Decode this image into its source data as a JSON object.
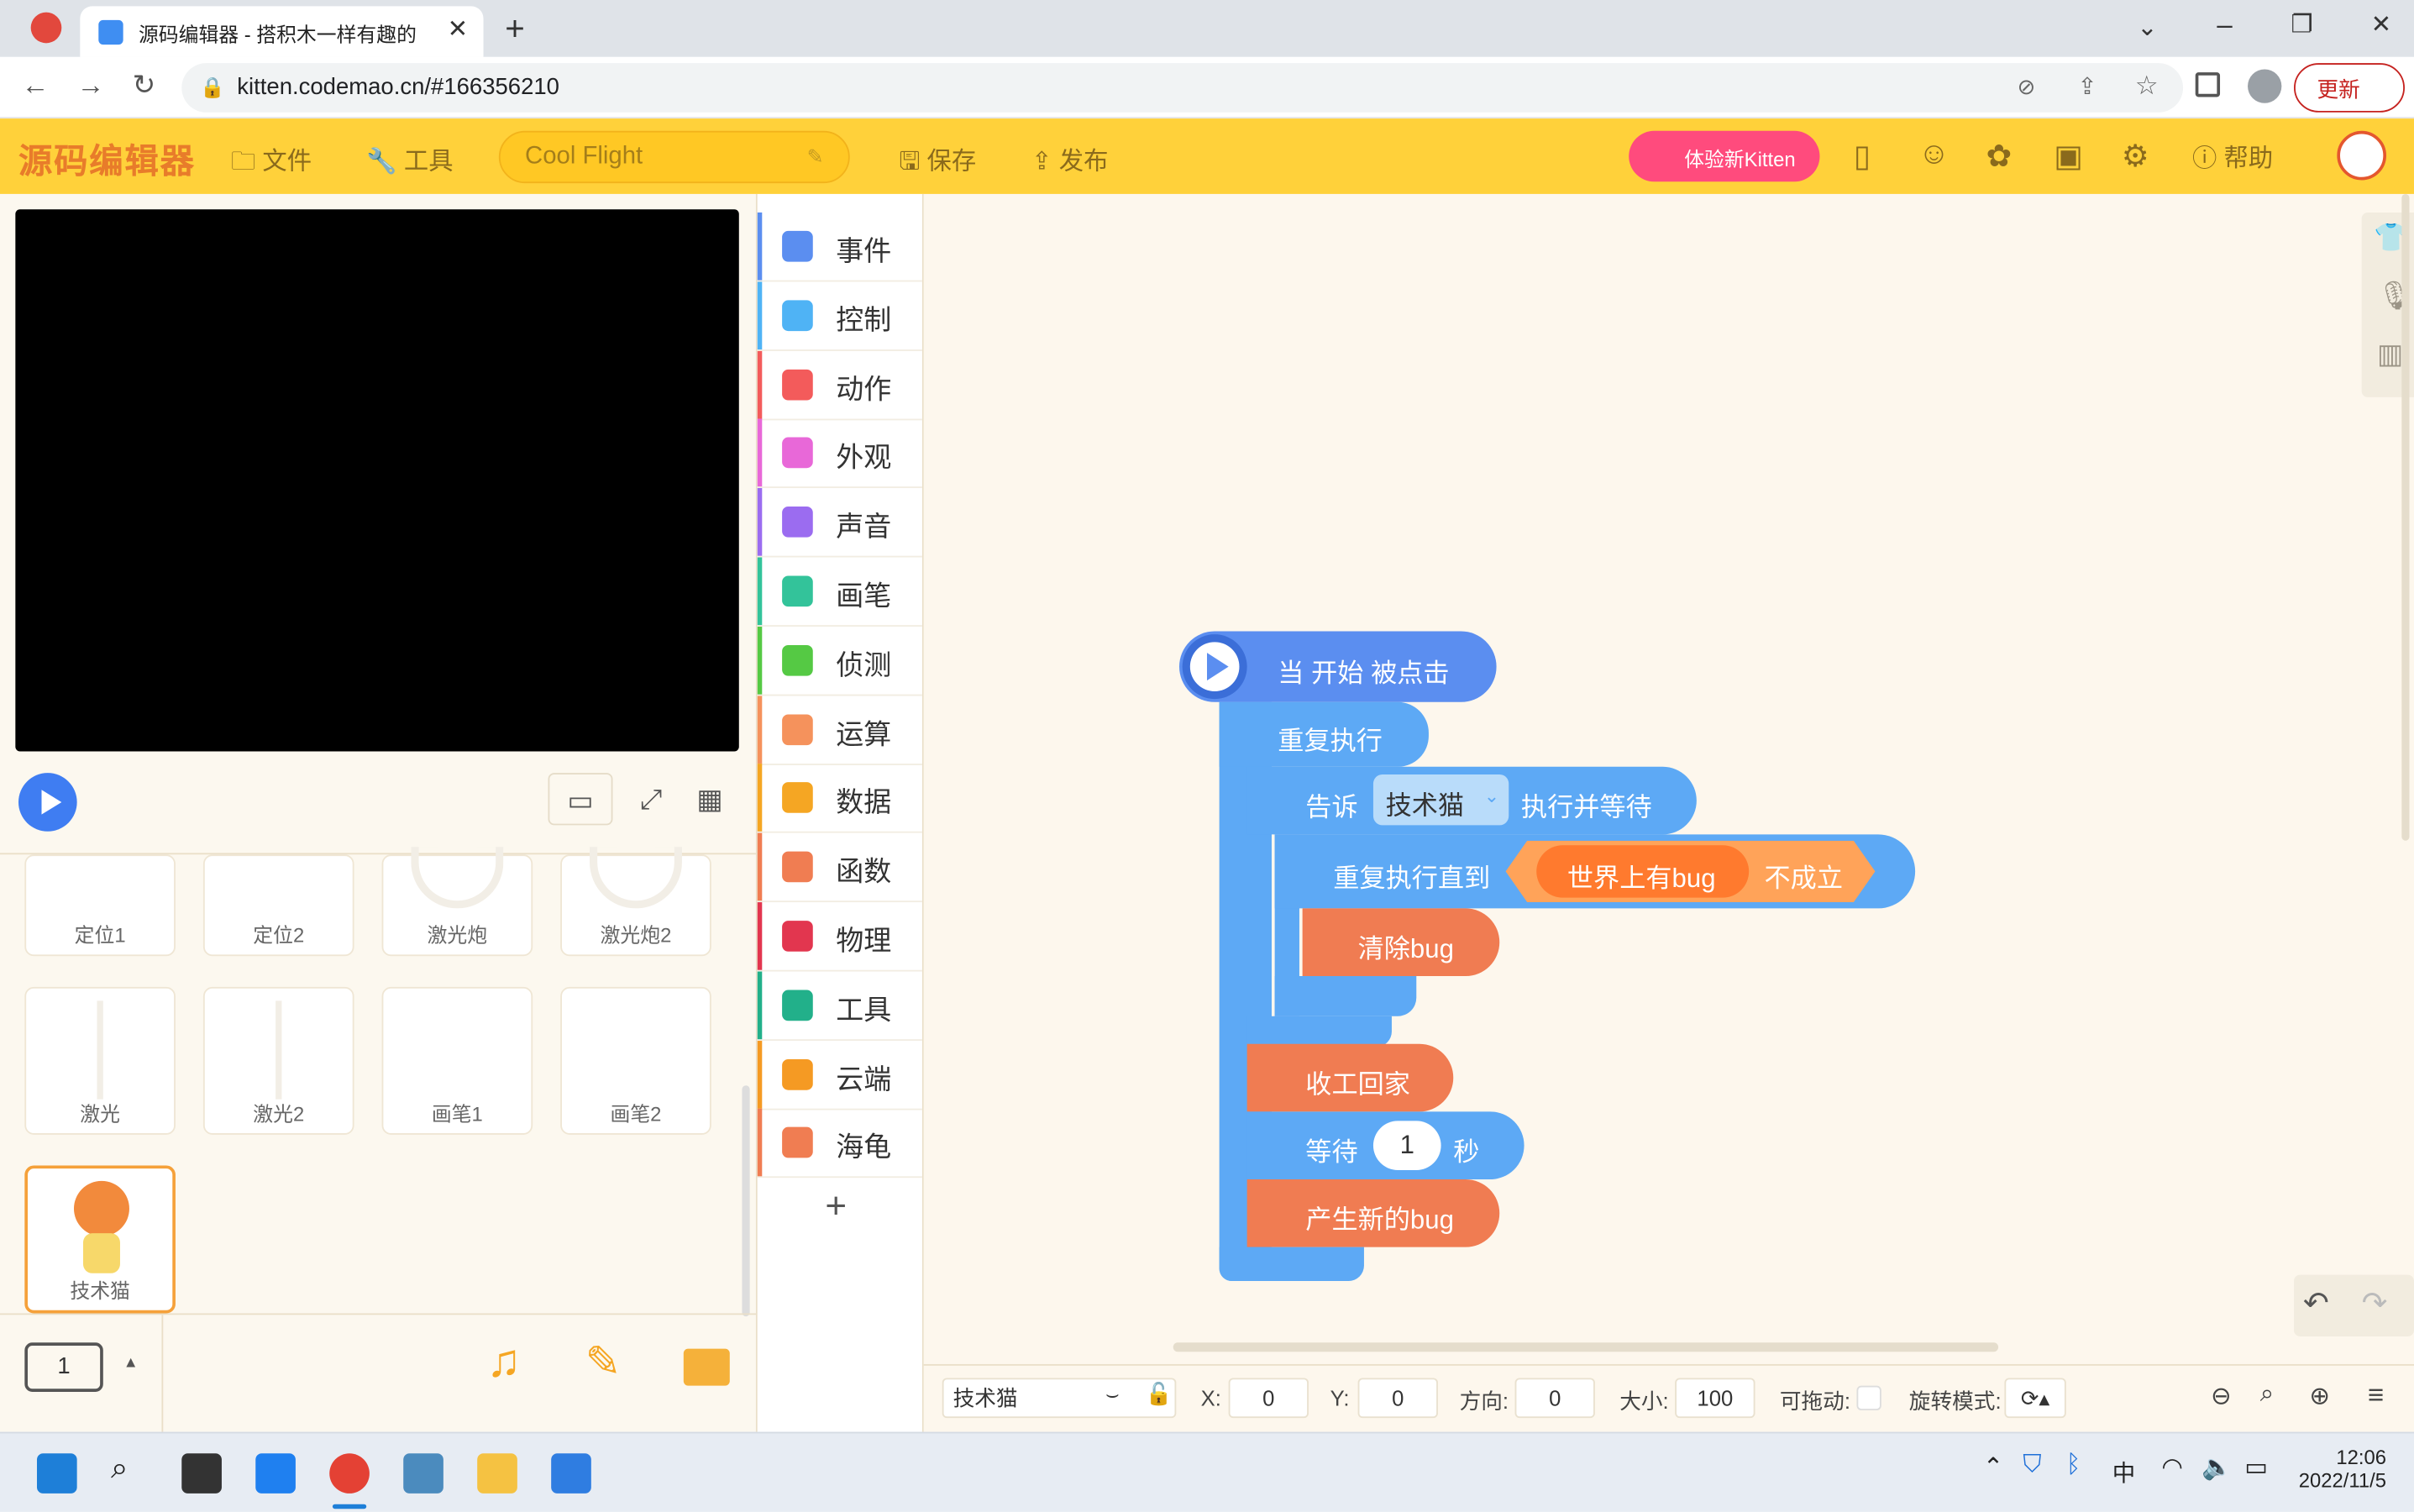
{
  "browser": {
    "tab_title": "源码编辑器 - 搭积木一样有趣的",
    "url": "kitten.codemao.cn/#166356210",
    "update_label": "更新"
  },
  "header": {
    "logo": "源码编辑器",
    "menu_file": "文件",
    "menu_tools": "工具",
    "project_name": "Cool Flight",
    "save": "保存",
    "publish": "发布",
    "kitten_btn": "体验新Kitten",
    "help": "帮助"
  },
  "categories": [
    {
      "label": "事件",
      "color": "#5b8ef0"
    },
    {
      "label": "控制",
      "color": "#4fb3f5"
    },
    {
      "label": "动作",
      "color": "#f35b5b"
    },
    {
      "label": "外观",
      "color": "#e868d8"
    },
    {
      "label": "声音",
      "color": "#9b6cf0"
    },
    {
      "label": "画笔",
      "color": "#33c39a"
    },
    {
      "label": "侦测",
      "color": "#55c944"
    },
    {
      "label": "运算",
      "color": "#f5925c"
    },
    {
      "label": "数据",
      "color": "#f5a623"
    },
    {
      "label": "函数",
      "color": "#f07d52"
    },
    {
      "label": "物理",
      "color": "#e2364f"
    },
    {
      "label": "工具",
      "color": "#22b08a"
    },
    {
      "label": "云端",
      "color": "#f59a23"
    },
    {
      "label": "海龟",
      "color": "#f07d52"
    }
  ],
  "sprites": {
    "row1": [
      "定位1",
      "定位2",
      "激光炮",
      "激光炮2"
    ],
    "row2": [
      "激光",
      "激光2",
      "画笔1",
      "画笔2"
    ],
    "selected": "技术猫"
  },
  "scene_number": "1",
  "blocks": {
    "when_start": "当 开始 被点击",
    "repeat_forever": "重复执行",
    "tell": "告诉",
    "tell_target": "技术猫",
    "tell_action": "执行并等待",
    "repeat_until": "重复执行直到",
    "condition": "世界上有bug",
    "not_hold": "不成立",
    "clear_bug": "清除bug",
    "go_home": "收工回家",
    "wait": "等待",
    "wait_value": "1",
    "seconds": "秒",
    "new_bug": "产生新的bug"
  },
  "props": {
    "sprite_name": "技术猫",
    "x_label": "X:",
    "x": "0",
    "y_label": "Y:",
    "y": "0",
    "dir_label": "方向:",
    "dir": "0",
    "size_label": "大小:",
    "size": "100",
    "drag_label": "可拖动:",
    "rotate_label": "旋转模式:"
  },
  "taskbar": {
    "time": "12:06",
    "date": "2022/11/5",
    "ime": "中"
  }
}
